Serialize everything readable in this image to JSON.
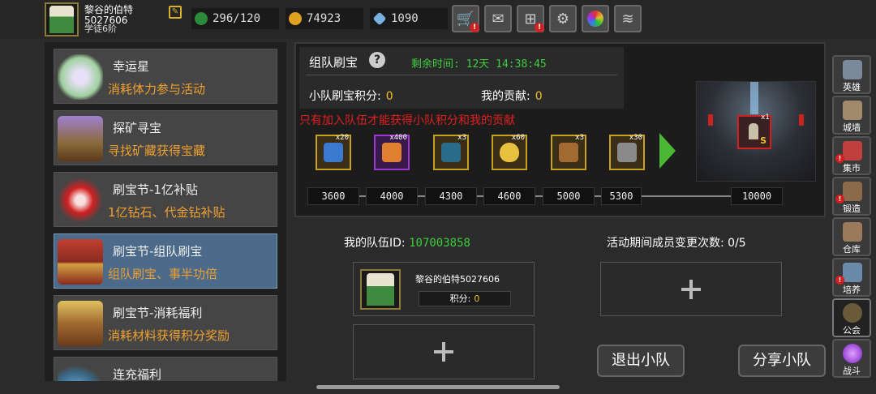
{
  "player": {
    "name": "黎谷的伯特",
    "id_line": "5027606",
    "rank": "学徒6阶",
    "stamina": "296/120",
    "gold": "74923",
    "gems": "1090"
  },
  "toolbar": {
    "icons": [
      "shop-cart-icon",
      "mail-icon",
      "gamepad-icon",
      "settings-gear-icon",
      "spin-wheel-icon",
      "wing-icon"
    ]
  },
  "events": [
    {
      "title": "幸运星",
      "desc": "消耗体力参与活动",
      "icon": "lucky-star-icon"
    },
    {
      "title": "探矿寻宝",
      "desc": "寻找矿藏获得宝藏",
      "icon": "treasure-mining-icon"
    },
    {
      "title": "刷宝节-1亿补贴",
      "desc": "1亿钻石、代金钻补贴",
      "icon": "red-flower-icon"
    },
    {
      "title": "刷宝节-组队刷宝",
      "desc": "组队刷宝、事半功倍",
      "icon": "chest-icon"
    },
    {
      "title": "刷宝节-消耗福利",
      "desc": "消耗材料获得积分奖励",
      "icon": "open-chest-icon"
    },
    {
      "title": "连充福利",
      "desc": "",
      "icon": "dragon-icon"
    }
  ],
  "panel": {
    "title": "组队刷宝",
    "time_label": "剩余时间:",
    "time_value": "12天 14:38:45",
    "team_score_label": "小队刷宝积分:",
    "team_score_value": "0",
    "my_contrib_label": "我的贡献:",
    "my_contrib_value": "0",
    "warning": "只有加入队伍才能获得小队积分和我的贡献",
    "rewards": [
      {
        "qty": "x20",
        "icon": "lightning-scroll-icon",
        "color": "#3a7ad0"
      },
      {
        "qty": "x400",
        "icon": "feather-icon",
        "color": "#9a3ad0"
      },
      {
        "qty": "x3",
        "icon": "spellbook-icon",
        "color": "#2a6a8a"
      },
      {
        "qty": "x60",
        "icon": "golden-egg-icon",
        "color": "#e8c040"
      },
      {
        "qty": "x3",
        "icon": "scroll-roll-icon",
        "color": "#a06a30"
      },
      {
        "qty": "x30",
        "icon": "hammer-icon",
        "color": "#8a8a8a"
      }
    ],
    "milestones": [
      "3600",
      "4000",
      "4300",
      "4600",
      "5000",
      "5300",
      "10000"
    ],
    "boss_reward_qty": "x1",
    "boss_reward_badge": "S"
  },
  "team": {
    "id_label": "我的队伍ID:",
    "id_value": "107003858",
    "changes_label": "活动期间成员变更次数:",
    "changes_value": "0/5",
    "member_name": "黎谷的伯特5027606",
    "member_score_label": "积分:",
    "member_score_value": "0",
    "leave_button": "退出小队",
    "share_button": "分享小队"
  },
  "rightnav": [
    {
      "label": "英雄",
      "icon": "helmet-icon",
      "alert": false
    },
    {
      "label": "城墙",
      "icon": "wall-icon",
      "alert": false
    },
    {
      "label": "集市",
      "icon": "market-icon",
      "alert": true
    },
    {
      "label": "锻造",
      "icon": "anvil-icon",
      "alert": true
    },
    {
      "label": "仓库",
      "icon": "warehouse-icon",
      "alert": false
    },
    {
      "label": "培养",
      "icon": "train-icon",
      "alert": true
    },
    {
      "label": "公会",
      "icon": "guild-icon",
      "alert": false
    },
    {
      "label": "战斗",
      "icon": "portal-icon",
      "alert": false
    }
  ],
  "colors": {
    "accent_green": "#3ecb3e",
    "warning_red": "#e02020",
    "desc_orange": "#f0a030",
    "value_gold": "#f0c020"
  }
}
